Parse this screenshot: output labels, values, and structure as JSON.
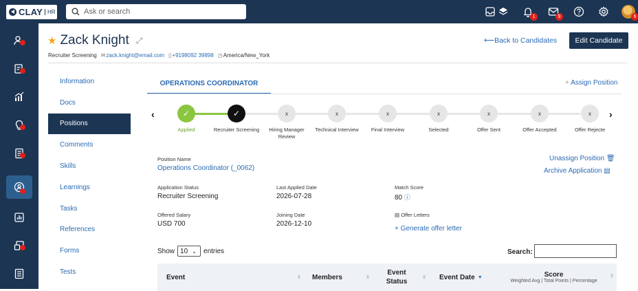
{
  "topbar": {
    "logo_brand": "CLAY",
    "logo_suffix": "HR",
    "search_placeholder": "Ask or search",
    "icons": [
      {
        "name": "inbox-icon",
        "badge": ""
      },
      {
        "name": "layers-icon",
        "badge": ""
      },
      {
        "name": "bell-icon",
        "badge": "1"
      },
      {
        "name": "mail-icon",
        "badge": "9"
      },
      {
        "name": "help-icon",
        "badge": ""
      },
      {
        "name": "gear-icon",
        "badge": ""
      }
    ],
    "avatar_badge": "6"
  },
  "sidebar": {
    "items": [
      {
        "name": "people-icon",
        "dot": true
      },
      {
        "name": "candidates-icon",
        "dot": true
      },
      {
        "name": "analytics-icon",
        "dot": false
      },
      {
        "name": "ideas-icon",
        "dot": true
      },
      {
        "name": "documents-icon",
        "dot": true
      },
      {
        "name": "recruitment-icon",
        "dot": true,
        "active": true
      },
      {
        "name": "reports-icon",
        "dot": false
      },
      {
        "name": "workflow-icon",
        "dot": true
      },
      {
        "name": "forms-icon",
        "dot": false
      }
    ]
  },
  "candidate": {
    "name": "Zack Knight",
    "stage": "Recruiter Screening",
    "email": "zack.knight@email.com",
    "phone": "+9198092 39898",
    "timezone": "America/New_York"
  },
  "header": {
    "back_label": "Back to Candidates",
    "edit_label": "Edit Candidate"
  },
  "leftnav": {
    "items": [
      "Information",
      "Docs",
      "Positions",
      "Comments",
      "Skills",
      "Learnings",
      "Tasks",
      "References",
      "Forms",
      "Tests"
    ],
    "active": "Positions"
  },
  "position": {
    "tab_label": "OPERATIONS COORDINATOR",
    "assign_label": "Assign Position",
    "stages": [
      {
        "label": "Applied",
        "state": "done",
        "mark": "✓"
      },
      {
        "label": "Recruiter Screening",
        "state": "current",
        "mark": "✓"
      },
      {
        "label": "Hiring Manager Review",
        "state": "pending",
        "mark": "x"
      },
      {
        "label": "Technical Interview",
        "state": "pending",
        "mark": "x"
      },
      {
        "label": "Final Interview",
        "state": "pending",
        "mark": "x"
      },
      {
        "label": "Selected",
        "state": "pending",
        "mark": "x"
      },
      {
        "label": "Offer Sent",
        "state": "pending",
        "mark": "x"
      },
      {
        "label": "Offer Accepted",
        "state": "pending",
        "mark": "x"
      },
      {
        "label": "Offer Rejecte",
        "state": "pending",
        "mark": "x"
      }
    ],
    "fields": {
      "position_name_label": "Position Name",
      "position_name_value": "Operations Coordinator (_0062)",
      "application_status_label": "Application Status",
      "application_status_value": "Recruiter Screening",
      "last_applied_label": "Last Applied Date",
      "last_applied_value": "2026-07-28",
      "match_score_label": "Match Score",
      "match_score_value": "80",
      "offered_salary_label": "Offered Salary",
      "offered_salary_value": "USD 700",
      "joining_date_label": "Joining Date",
      "joining_date_value": "2026-12-10",
      "offer_letters_label": "Offer Letters",
      "generate_offer_label": "Generate offer letter"
    },
    "unassign_label": "Unassign Position",
    "archive_label": "Archive Application"
  },
  "table": {
    "show_label": "Show",
    "entries_value": "10",
    "entries_label": "entries",
    "search_label": "Search:",
    "columns": [
      "Event",
      "Members",
      "Event Status",
      "Event Date",
      "Score"
    ],
    "score_sub": "Weighted Avg | Total Points | Percentage"
  },
  "colors": {
    "navy": "#1c3553",
    "link": "#2a6bb2",
    "done": "#8cc53f",
    "badge": "#e0201b"
  }
}
